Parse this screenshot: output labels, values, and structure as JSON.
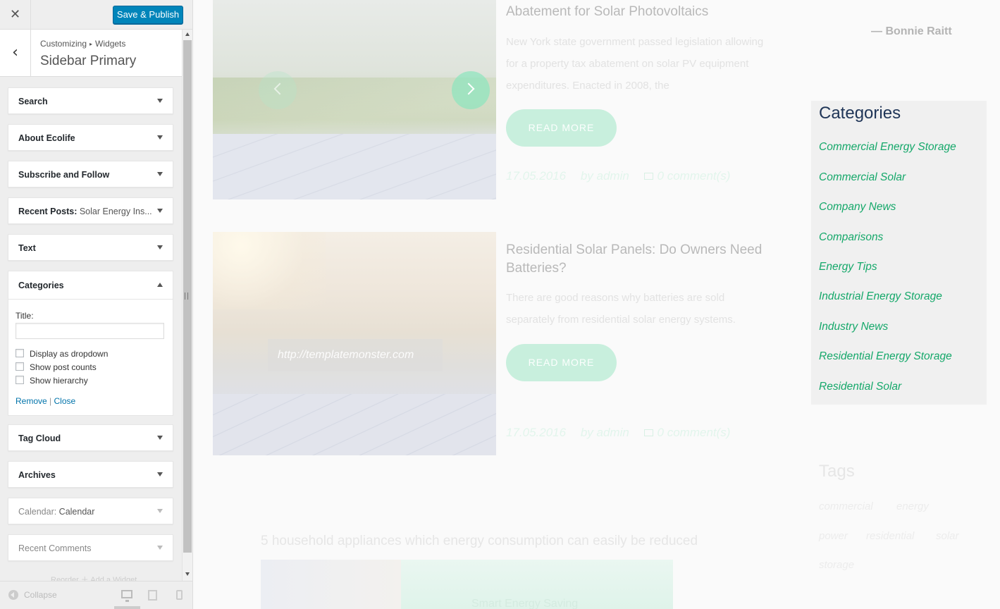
{
  "customizer": {
    "close_glyph": "✕",
    "save_publish_label": "Save & Publish",
    "back_glyph": "‹",
    "breadcrumb": [
      "Customizing",
      "Widgets"
    ],
    "breadcrumb_sep": "▸",
    "section_title": "Sidebar Primary",
    "widgets_top": [
      {
        "title": "Search",
        "sub": ""
      },
      {
        "title": "About Ecolife",
        "sub": ""
      },
      {
        "title": "Subscribe and Follow",
        "sub": ""
      },
      {
        "title": "Recent Posts:",
        "sub": " Solar Energy Ins..."
      },
      {
        "title": "Text",
        "sub": ""
      }
    ],
    "expanded_widget": {
      "title": "Categories",
      "title_label": "Title:",
      "title_value": "",
      "options": [
        "Display as dropdown",
        "Show post counts",
        "Show hierarchy"
      ],
      "remove_label": "Remove",
      "separator": "|",
      "close_label": "Close"
    },
    "widgets_bottom": [
      {
        "title": "Tag Cloud",
        "sub": ""
      },
      {
        "title": "Archives",
        "sub": ""
      },
      {
        "title": "Calendar:",
        "sub": " Calendar"
      },
      {
        "title": "Recent Comments",
        "sub": ""
      }
    ],
    "footer_faded": "Reorder     ＋ Add a Widget",
    "collapse_label": "Collapse"
  },
  "preview": {
    "post1": {
      "title": "Abatement for Solar Photovoltaics",
      "excerpt": "New York state government passed legislation allowing for a property tax abatement on solar PV equipment expenditures. Enacted in 2008, the",
      "read_more": "READ MORE",
      "date": "17.05.2016",
      "author": "by admin",
      "comments": "0 comment(s)"
    },
    "post2": {
      "title": "Residential Solar Panels: Do Owners Need Batteries?",
      "excerpt": "There are good reasons why batteries are sold separately from residential solar energy systems.",
      "read_more": "READ MORE",
      "date": "17.05.2016",
      "author": "by admin",
      "comments": "0 comment(s)",
      "image_caption": "http://templatemonster.com"
    },
    "post3": {
      "title": "5 household appliances which energy consumption can easily be reduced",
      "overlay": "Smart Energy Saving"
    },
    "quote_author": "— Bonnie Raitt",
    "categories": {
      "title": "Categories",
      "items": [
        "Commercial Energy Storage",
        "Commercial Solar",
        "Company News",
        "Comparisons",
        "Energy Tips",
        "Industrial Energy Storage",
        "Industry News",
        "Residential Energy Storage",
        "Residential Solar"
      ]
    },
    "tags": {
      "title": "Tags",
      "items": [
        "commercial",
        "energy",
        "power",
        "residential",
        "solar",
        "storage"
      ]
    },
    "colors": {
      "accent_button": "#0085ba",
      "category_link": "#15a86a",
      "category_title": "#1f3557",
      "read_more_bg": "#c8efdd"
    }
  }
}
